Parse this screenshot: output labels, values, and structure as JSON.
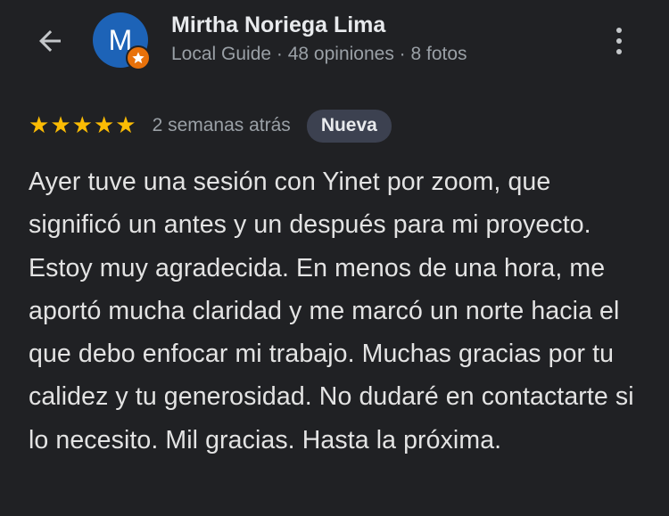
{
  "header": {
    "back_icon": "arrow-back-icon",
    "avatar_letter": "M",
    "avatar_color": "#1d63b7",
    "badge_icon": "local-guide-star-icon",
    "badge_color": "#e8710a",
    "user_name": "Mirtha Noriega Lima",
    "user_meta": "Local Guide · 48 opiniones · 8 fotos",
    "more_icon": "more-vertical-icon"
  },
  "review": {
    "stars": 5,
    "star_color": "#fbbc04",
    "time": "2 semanas atrás",
    "badge": "Nueva",
    "text": "Ayer tuve una sesión con Yinet por zoom, que significó un antes y un después para mi proyecto. Estoy muy agradecida. En menos de una hora, me aportó mucha claridad y me marcó un norte hacia el que debo enfocar mi trabajo. Muchas gracias por tu calidez y tu generosidad. No dudaré en contactarte si lo necesito. Mil gracias. Hasta la próxima."
  }
}
